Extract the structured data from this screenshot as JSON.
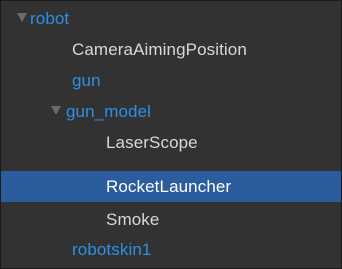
{
  "tree": {
    "items": [
      {
        "label": "robot",
        "depth": 0,
        "expandable": true,
        "expanded": true,
        "is_prefab": true,
        "selected": false
      },
      {
        "label": "CameraAimingPosition",
        "depth": 1,
        "expandable": false,
        "is_prefab": false,
        "selected": false
      },
      {
        "label": "gun",
        "depth": 1,
        "expandable": false,
        "is_prefab": true,
        "selected": false
      },
      {
        "label": "gun_model",
        "depth": 1,
        "expandable": true,
        "expanded": true,
        "is_prefab": true,
        "selected": false
      },
      {
        "label": "LaserScope",
        "depth": 2,
        "expandable": false,
        "is_prefab": false,
        "selected": false
      },
      {
        "label": "RocketLauncher",
        "depth": 2,
        "expandable": false,
        "is_prefab": false,
        "selected": true
      },
      {
        "label": "Smoke",
        "depth": 2,
        "expandable": false,
        "is_prefab": false,
        "selected": false
      },
      {
        "label": "robotskin1",
        "depth": 1,
        "expandable": false,
        "is_prefab": true,
        "selected": false
      }
    ]
  },
  "colors": {
    "background": "#323232",
    "selection": "#2b5d9e",
    "prefab_text": "#2d8fe6",
    "normal_text": "#d8d8d8",
    "arrow": "#6a6a6a"
  }
}
